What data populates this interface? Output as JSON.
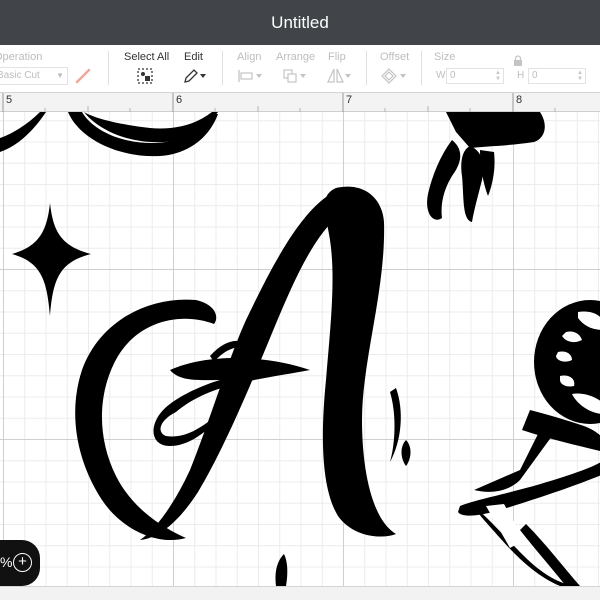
{
  "window": {
    "title": "Untitled"
  },
  "toolbar": {
    "operation": {
      "label": "Operation",
      "value": "Basic Cut"
    },
    "select_all": {
      "label": "Select All",
      "icon": "select-all-icon"
    },
    "edit": {
      "label": "Edit",
      "icon": "pen-icon"
    },
    "align": {
      "label": "Align",
      "icon": "align-icon"
    },
    "arrange": {
      "label": "Arrange",
      "icon": "arrange-icon"
    },
    "flip": {
      "label": "Flip",
      "icon": "flip-icon"
    },
    "offset": {
      "label": "Offset",
      "icon": "offset-icon"
    },
    "size": {
      "label": "Size",
      "w_label": "W",
      "w_value": "0",
      "h_label": "H",
      "h_value": "0",
      "lock_icon": "lock-icon"
    }
  },
  "ruler": {
    "marks": [
      "5",
      "6",
      "7",
      "8"
    ]
  },
  "canvas": {
    "artwork": [
      "flourish-shape",
      "sparkle-star",
      "script-letter-a",
      "decorative-figure",
      "spinning-wheel"
    ]
  },
  "zoom": {
    "suffix": "%",
    "plus_icon": "zoom-in-icon"
  },
  "colors": {
    "titlebar": "#414549",
    "ink": "#000000",
    "grid_major": "#cfcfcf",
    "grid_minor": "#ececec"
  }
}
